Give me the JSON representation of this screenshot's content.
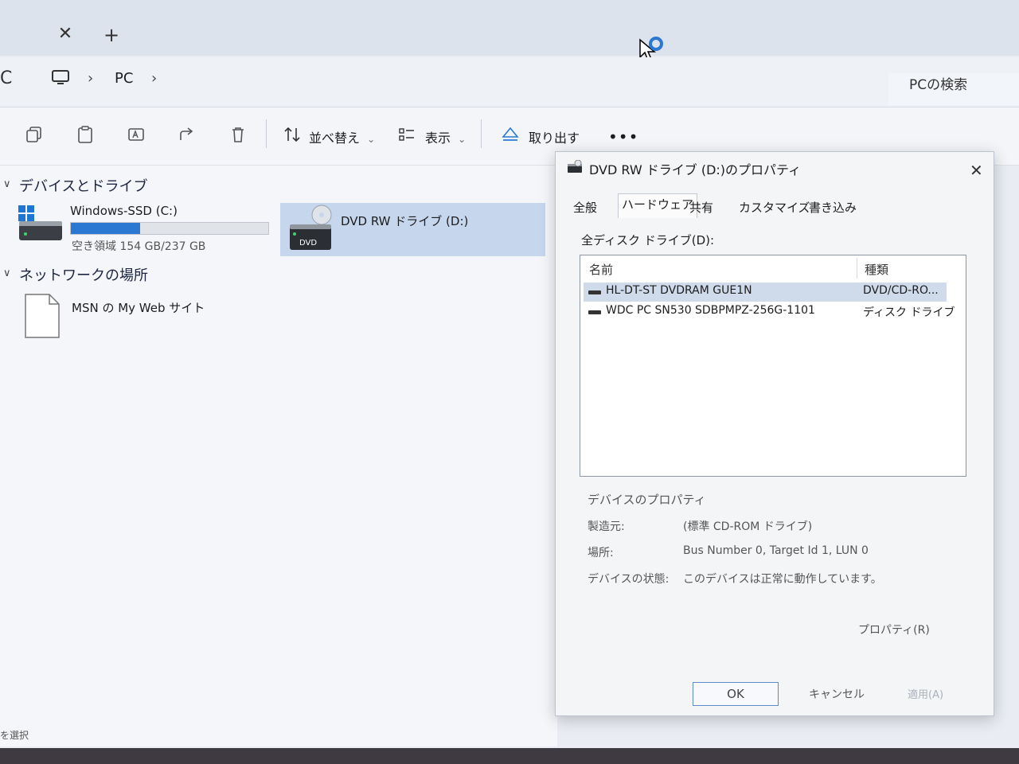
{
  "tabbar": {
    "close_glyph": "✕",
    "new_tab_glyph": "+"
  },
  "address": {
    "refresh_glyph": "C",
    "chevron": "›",
    "crumb": "PC",
    "search_placeholder": "PCの検索"
  },
  "toolbar": {
    "sort_label": "並べ替え",
    "view_label": "表示",
    "eject_label": "取り出す",
    "more_label": "•••",
    "dropdown_glyph": "⌄",
    "icons": [
      "copy-icon",
      "paste-icon",
      "rename-icon",
      "share-icon",
      "delete-icon"
    ]
  },
  "sections": {
    "devices": {
      "title": "デバイスとドライブ",
      "chevron": "∨"
    },
    "network": {
      "title": "ネットワークの場所",
      "chevron": "∨"
    }
  },
  "drives": {
    "c": {
      "name": "Windows-SSD (C:)",
      "space": "空き領域 154 GB/237 GB",
      "used_fraction": 0.35
    },
    "d": {
      "name": "DVD RW ドライブ (D:)",
      "badge": "DVD"
    }
  },
  "network_items": [
    {
      "name": "MSN の My Web サイト"
    }
  ],
  "statusbar": {
    "text": "を選択"
  },
  "dialog": {
    "title": "DVD RW ドライブ (D:)のプロパティ",
    "close_glyph": "✕",
    "tabs": [
      "全般",
      "ハードウェア",
      "共有",
      "カスタマイズ",
      "書き込み"
    ],
    "active_tab": "ハードウェア",
    "all_drives_label": "全ディスク ドライブ(D):",
    "columns": [
      "名前",
      "種類"
    ],
    "rows": [
      {
        "name": "HL-DT-ST DVDRAM GUE1N",
        "type": "DVD/CD-RO..."
      },
      {
        "name": "WDC PC SN530 SDBPMPZ-256G-1101",
        "type": "ディスク ドライブ"
      }
    ],
    "device_props_title": "デバイスのプロパティ",
    "props": [
      {
        "key": "製造元:",
        "value": "(標準 CD-ROM ドライブ)"
      },
      {
        "key": "場所:",
        "value": "Bus Number 0, Target Id 1, LUN 0"
      },
      {
        "key": "デバイスの状態:",
        "value": "このデバイスは正常に動作しています。"
      }
    ],
    "properties_button": "プロパティ(R)",
    "ok": "OK",
    "cancel": "キャンセル",
    "apply": "適用(A)"
  },
  "colors": {
    "accent": "#2b78d3",
    "selection": "#c6d6ec",
    "window_bg": "#f4f6f9"
  }
}
